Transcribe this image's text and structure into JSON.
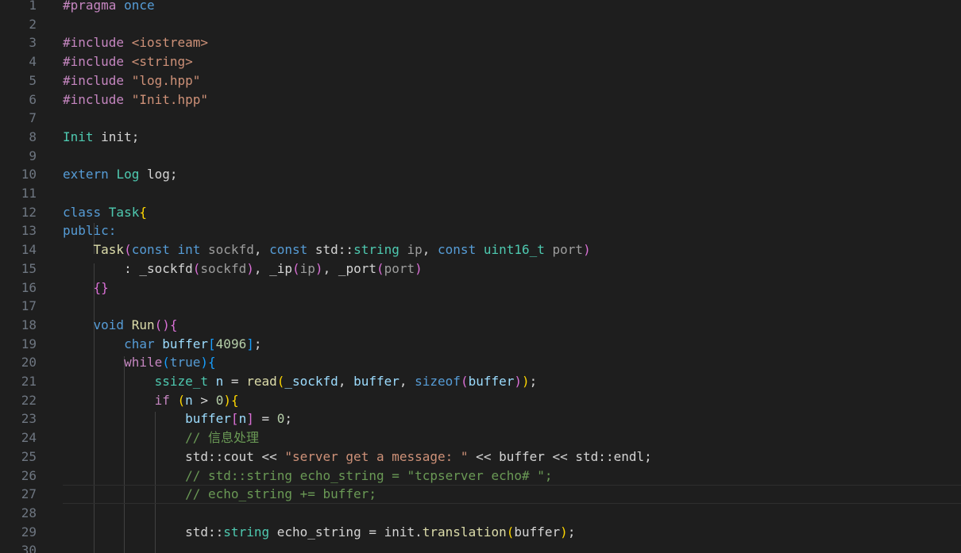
{
  "editor": {
    "lines": [
      {
        "n": "1",
        "tokens": [
          [
            "pp",
            "#pragma "
          ],
          [
            "kw",
            "once"
          ]
        ]
      },
      {
        "n": "2",
        "tokens": []
      },
      {
        "n": "3",
        "tokens": [
          [
            "pp",
            "#include "
          ],
          [
            "str",
            "<iostream>"
          ]
        ]
      },
      {
        "n": "4",
        "tokens": [
          [
            "pp",
            "#include "
          ],
          [
            "str",
            "<string>"
          ]
        ]
      },
      {
        "n": "5",
        "tokens": [
          [
            "pp",
            "#include "
          ],
          [
            "str",
            "\"log.hpp\""
          ]
        ]
      },
      {
        "n": "6",
        "tokens": [
          [
            "pp",
            "#include "
          ],
          [
            "str",
            "\"Init.hpp\""
          ]
        ]
      },
      {
        "n": "7",
        "tokens": []
      },
      {
        "n": "8",
        "tokens": [
          [
            "ty",
            "Init"
          ],
          [
            "plain",
            " init;"
          ]
        ]
      },
      {
        "n": "9",
        "tokens": []
      },
      {
        "n": "10",
        "tokens": [
          [
            "kw",
            "extern "
          ],
          [
            "ty",
            "Log"
          ],
          [
            "plain",
            " log;"
          ]
        ]
      },
      {
        "n": "11",
        "tokens": []
      },
      {
        "n": "12",
        "tokens": [
          [
            "kw",
            "class "
          ],
          [
            "ty",
            "Task"
          ],
          [
            "b1",
            "{"
          ]
        ]
      },
      {
        "n": "13",
        "tokens": [
          [
            "kw",
            "public:"
          ]
        ]
      },
      {
        "n": "14",
        "tokens": [
          [
            "plain",
            "    "
          ],
          [
            "fn",
            "Task"
          ],
          [
            "b2",
            "("
          ],
          [
            "kw",
            "const "
          ],
          [
            "kw",
            "int "
          ],
          [
            "par",
            "sockfd"
          ],
          [
            "plain",
            ", "
          ],
          [
            "kw",
            "const "
          ],
          [
            "plain",
            "std::"
          ],
          [
            "ty",
            "string "
          ],
          [
            "par",
            "ip"
          ],
          [
            "plain",
            ", "
          ],
          [
            "kw",
            "const "
          ],
          [
            "ty",
            "uint16_t "
          ],
          [
            "par",
            "port"
          ],
          [
            "b2",
            ")"
          ]
        ]
      },
      {
        "n": "15",
        "tokens": [
          [
            "plain",
            "        : _sockfd"
          ],
          [
            "b2",
            "("
          ],
          [
            "par",
            "sockfd"
          ],
          [
            "b2",
            ")"
          ],
          [
            "plain",
            ", _ip"
          ],
          [
            "b2",
            "("
          ],
          [
            "par",
            "ip"
          ],
          [
            "b2",
            ")"
          ],
          [
            "plain",
            ", _port"
          ],
          [
            "b2",
            "("
          ],
          [
            "par",
            "port"
          ],
          [
            "b2",
            ")"
          ]
        ]
      },
      {
        "n": "16",
        "tokens": [
          [
            "plain",
            "    "
          ],
          [
            "b2",
            "{}"
          ]
        ]
      },
      {
        "n": "17",
        "tokens": []
      },
      {
        "n": "18",
        "tokens": [
          [
            "plain",
            "    "
          ],
          [
            "kw",
            "void "
          ],
          [
            "fn",
            "Run"
          ],
          [
            "b2",
            "()"
          ],
          [
            "b2",
            "{"
          ]
        ]
      },
      {
        "n": "19",
        "tokens": [
          [
            "plain",
            "        "
          ],
          [
            "kw",
            "char "
          ],
          [
            "var",
            "buffer"
          ],
          [
            "b3",
            "["
          ],
          [
            "num",
            "4096"
          ],
          [
            "b3",
            "]"
          ],
          [
            "plain",
            ";"
          ]
        ]
      },
      {
        "n": "20",
        "tokens": [
          [
            "plain",
            "        "
          ],
          [
            "ctl",
            "while"
          ],
          [
            "b3",
            "("
          ],
          [
            "kw",
            "true"
          ],
          [
            "b3",
            ")"
          ],
          [
            "b3",
            "{"
          ]
        ]
      },
      {
        "n": "21",
        "tokens": [
          [
            "plain",
            "            "
          ],
          [
            "ty",
            "ssize_t "
          ],
          [
            "var",
            "n"
          ],
          [
            "plain",
            " = "
          ],
          [
            "fn",
            "read"
          ],
          [
            "b1",
            "("
          ],
          [
            "var",
            "_sockfd"
          ],
          [
            "plain",
            ", "
          ],
          [
            "var",
            "buffer"
          ],
          [
            "plain",
            ", "
          ],
          [
            "kw",
            "sizeof"
          ],
          [
            "b2",
            "("
          ],
          [
            "var",
            "buffer"
          ],
          [
            "b2",
            ")"
          ],
          [
            "b1",
            ")"
          ],
          [
            "plain",
            ";"
          ]
        ]
      },
      {
        "n": "22",
        "tokens": [
          [
            "plain",
            "            "
          ],
          [
            "ctl",
            "if "
          ],
          [
            "b1",
            "("
          ],
          [
            "var",
            "n"
          ],
          [
            "plain",
            " > "
          ],
          [
            "num",
            "0"
          ],
          [
            "b1",
            ")"
          ],
          [
            "b1",
            "{"
          ]
        ]
      },
      {
        "n": "23",
        "tokens": [
          [
            "plain",
            "                "
          ],
          [
            "var",
            "buffer"
          ],
          [
            "b2",
            "["
          ],
          [
            "var",
            "n"
          ],
          [
            "b2",
            "]"
          ],
          [
            "plain",
            " = "
          ],
          [
            "num",
            "0"
          ],
          [
            "plain",
            ";"
          ]
        ]
      },
      {
        "n": "24",
        "tokens": [
          [
            "plain",
            "                "
          ],
          [
            "cmt",
            "// 信息处理"
          ]
        ]
      },
      {
        "n": "25",
        "tokens": [
          [
            "plain",
            "                std::cout << "
          ],
          [
            "str",
            "\"server get a message: \""
          ],
          [
            "plain",
            " << buffer << std::endl;"
          ]
        ]
      },
      {
        "n": "26",
        "tokens": [
          [
            "plain",
            "                "
          ],
          [
            "cmt",
            "// std::string echo_string = \"tcpserver echo# \";"
          ]
        ]
      },
      {
        "n": "27",
        "tokens": [
          [
            "plain",
            "                "
          ],
          [
            "cmt",
            "// echo_string += buffer;"
          ]
        ],
        "current": true
      },
      {
        "n": "28",
        "tokens": []
      },
      {
        "n": "29",
        "tokens": [
          [
            "plain",
            "                std::"
          ],
          [
            "ty",
            "string "
          ],
          [
            "plain",
            "echo_string = init."
          ],
          [
            "fn",
            "translation"
          ],
          [
            "b1",
            "("
          ],
          [
            "plain",
            "buffer"
          ],
          [
            "b1",
            ")"
          ],
          [
            "plain",
            ";"
          ]
        ]
      },
      {
        "n": "30",
        "tokens": []
      }
    ]
  }
}
